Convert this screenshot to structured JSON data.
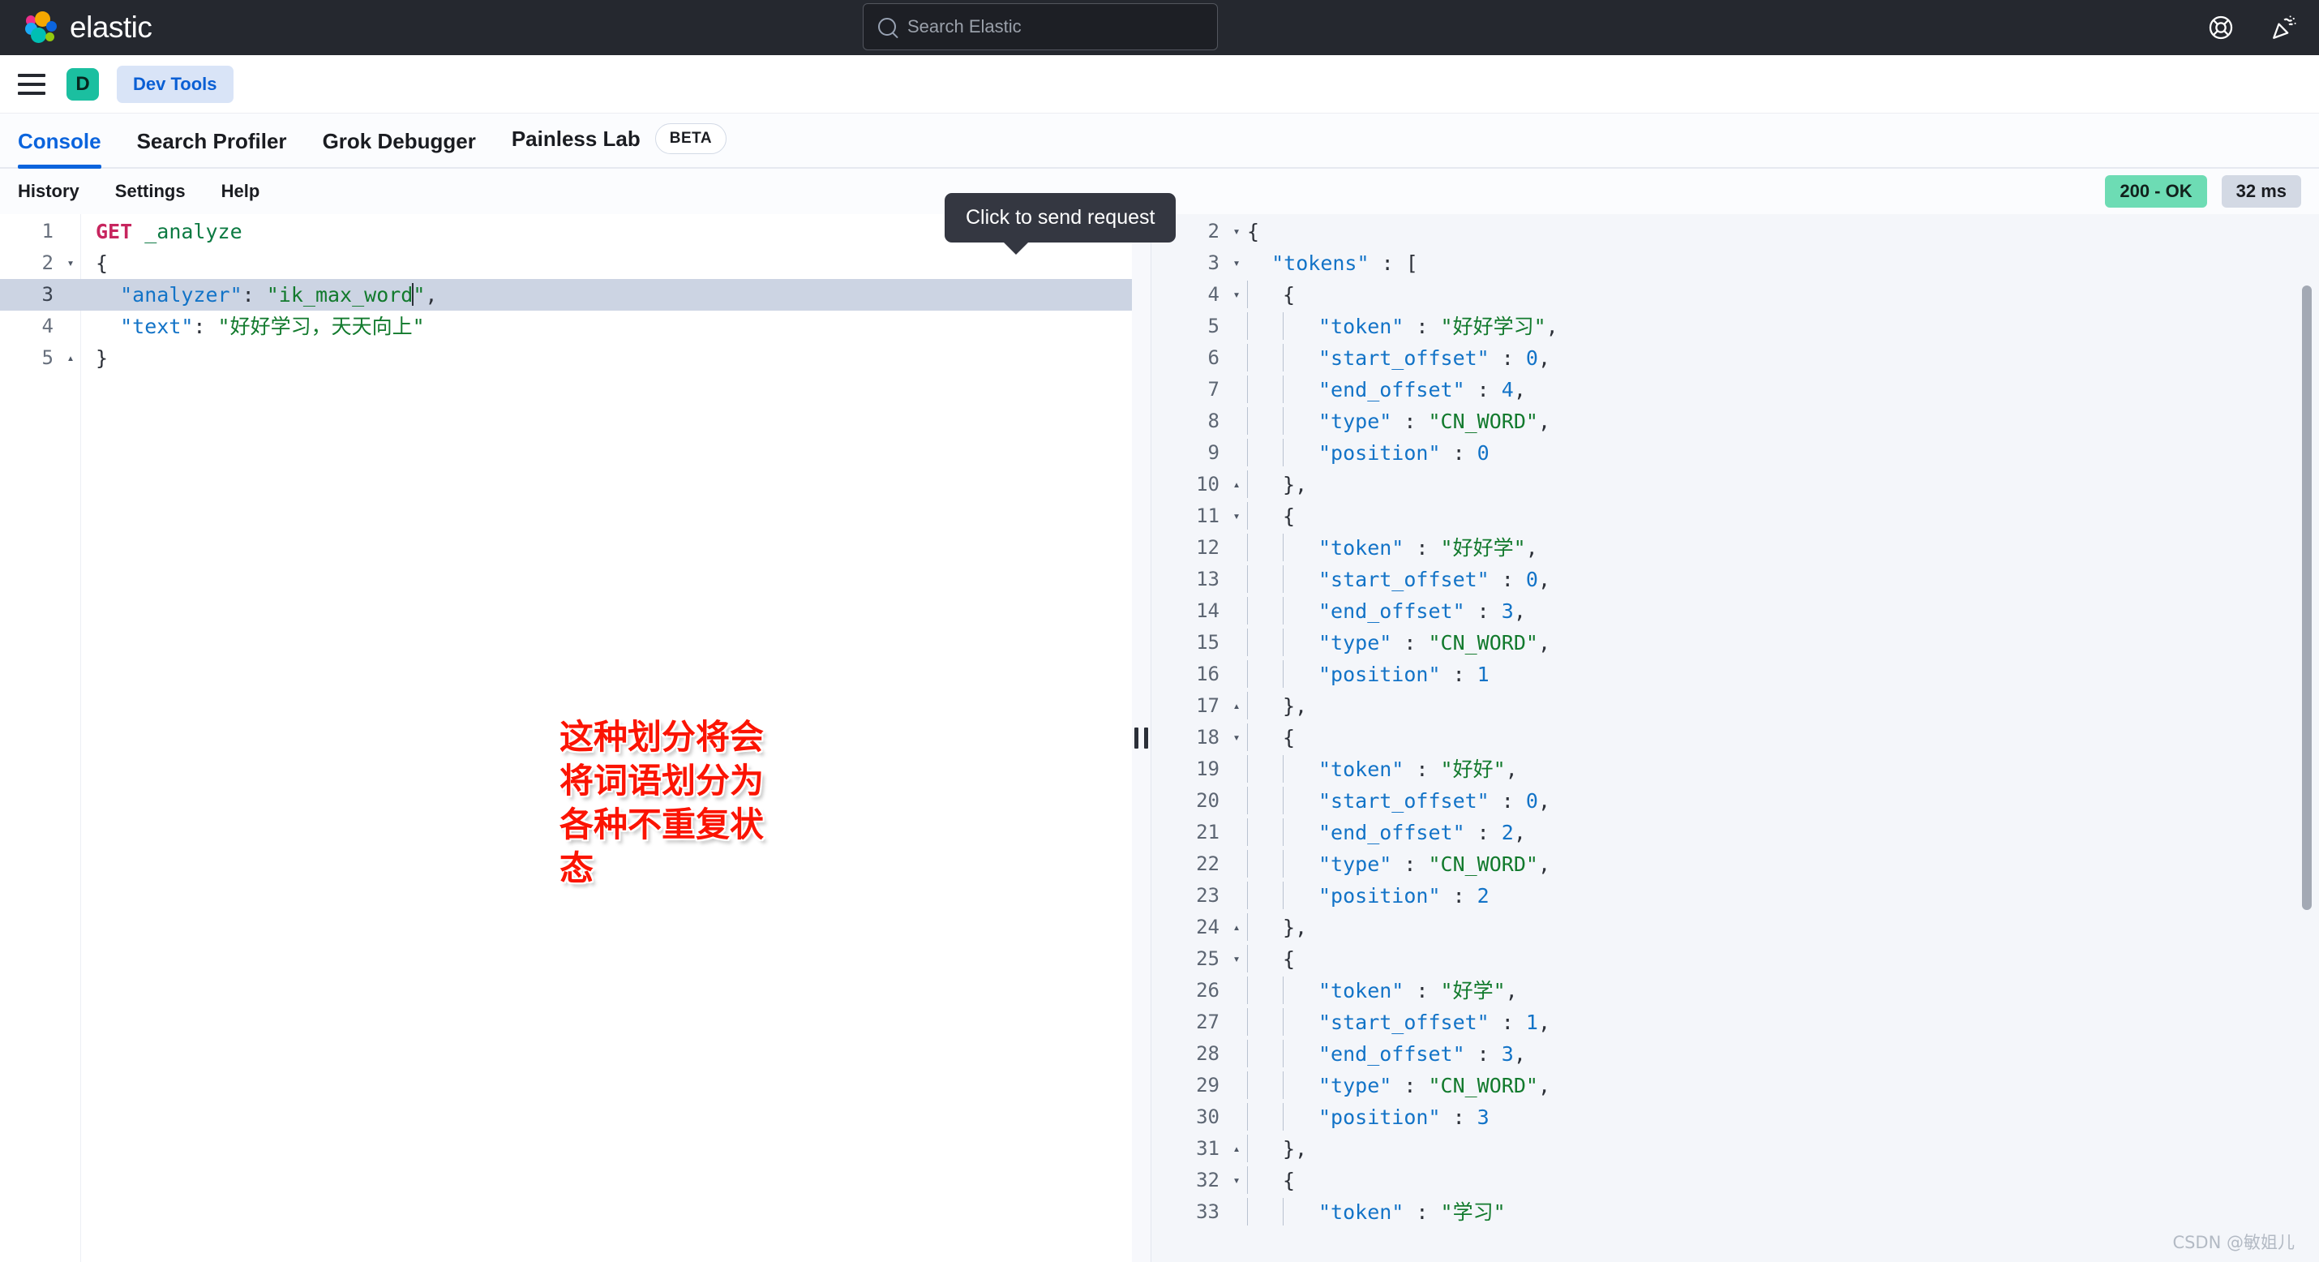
{
  "topbar": {
    "brand": "elastic",
    "brand_icon": "elastic-logo-icon",
    "search_placeholder": "Search Elastic",
    "search_icon": "search-icon",
    "help_icon": "lifebuoy-help-icon",
    "news_icon": "party-popper-news-icon",
    "bg": "#25282f"
  },
  "navbar": {
    "menu_icon": "hamburger-menu-icon",
    "space_initial": "D",
    "space_color": "#1bbfa0",
    "breadcrumb": "Dev Tools",
    "breadcrumb_color": "#0a5fd4"
  },
  "tabs": [
    {
      "label": "Console",
      "active": true
    },
    {
      "label": "Search Profiler",
      "active": false
    },
    {
      "label": "Grok Debugger",
      "active": false
    },
    {
      "label": "Painless Lab",
      "active": false,
      "badge": "BETA"
    }
  ],
  "actionbar": {
    "links": [
      "History",
      "Settings",
      "Help"
    ],
    "status": "200 - OK",
    "status_color": "#6ddcb4",
    "duration": "32 ms"
  },
  "tooltip": {
    "text": "Click to send request"
  },
  "run_controls": {
    "play_icon": "play-send-request-icon",
    "wrench_icon": "wrench-settings-icon",
    "play_color": "#0f7a63",
    "wrench_color": "#0b64dd"
  },
  "editor": {
    "lines": [
      {
        "n": "1",
        "fold": "",
        "active": false,
        "tokens": [
          {
            "t": "GET",
            "c": "k-method"
          },
          {
            "t": " ",
            "c": "k-plain"
          },
          {
            "t": "_analyze",
            "c": "k-url"
          }
        ]
      },
      {
        "n": "2",
        "fold": "▾",
        "active": false,
        "tokens": [
          {
            "t": "{",
            "c": "k-punct"
          }
        ]
      },
      {
        "n": "3",
        "fold": "",
        "active": true,
        "tokens": [
          {
            "t": "  ",
            "c": "k-plain"
          },
          {
            "t": "\"analyzer\"",
            "c": "k-key"
          },
          {
            "t": ": ",
            "c": "k-punct"
          },
          {
            "t": "\"ik_max_word\"",
            "c": "k-str"
          },
          {
            "t": ",",
            "c": "k-punct"
          }
        ]
      },
      {
        "n": "4",
        "fold": "",
        "active": false,
        "tokens": [
          {
            "t": "  ",
            "c": "k-plain"
          },
          {
            "t": "\"text\"",
            "c": "k-key"
          },
          {
            "t": ": ",
            "c": "k-punct"
          },
          {
            "t": "\"好好学习，天天向上\"",
            "c": "k-str"
          }
        ]
      },
      {
        "n": "5",
        "fold": "▴",
        "active": false,
        "tokens": [
          {
            "t": "}",
            "c": "k-punct"
          }
        ]
      }
    ]
  },
  "response": {
    "lines": [
      {
        "n": "2",
        "fold": "▾",
        "ind": 0,
        "tokens": [
          {
            "t": "{",
            "c": "k-punct"
          }
        ]
      },
      {
        "n": "3",
        "fold": "▾",
        "ind": 0,
        "tokens": [
          {
            "t": "  ",
            "c": "k-plain"
          },
          {
            "t": "\"tokens\"",
            "c": "k-key"
          },
          {
            "t": " : ",
            "c": "k-punct"
          },
          {
            "t": "[",
            "c": "k-punct"
          }
        ]
      },
      {
        "n": "4",
        "fold": "▾",
        "ind": 1,
        "tokens": [
          {
            "t": "{",
            "c": "k-punct"
          }
        ]
      },
      {
        "n": "5",
        "fold": "",
        "ind": 2,
        "tokens": [
          {
            "t": "\"token\"",
            "c": "k-key"
          },
          {
            "t": " : ",
            "c": "k-punct"
          },
          {
            "t": "\"好好学习\"",
            "c": "k-str"
          },
          {
            "t": ",",
            "c": "k-punct"
          }
        ]
      },
      {
        "n": "6",
        "fold": "",
        "ind": 2,
        "tokens": [
          {
            "t": "\"start_offset\"",
            "c": "k-key"
          },
          {
            "t": " : ",
            "c": "k-punct"
          },
          {
            "t": "0",
            "c": "k-num"
          },
          {
            "t": ",",
            "c": "k-punct"
          }
        ]
      },
      {
        "n": "7",
        "fold": "",
        "ind": 2,
        "tokens": [
          {
            "t": "\"end_offset\"",
            "c": "k-key"
          },
          {
            "t": " : ",
            "c": "k-punct"
          },
          {
            "t": "4",
            "c": "k-num"
          },
          {
            "t": ",",
            "c": "k-punct"
          }
        ]
      },
      {
        "n": "8",
        "fold": "",
        "ind": 2,
        "tokens": [
          {
            "t": "\"type\"",
            "c": "k-key"
          },
          {
            "t": " : ",
            "c": "k-punct"
          },
          {
            "t": "\"CN_WORD\"",
            "c": "k-str"
          },
          {
            "t": ",",
            "c": "k-punct"
          }
        ]
      },
      {
        "n": "9",
        "fold": "",
        "ind": 2,
        "tokens": [
          {
            "t": "\"position\"",
            "c": "k-key"
          },
          {
            "t": " : ",
            "c": "k-punct"
          },
          {
            "t": "0",
            "c": "k-num"
          }
        ]
      },
      {
        "n": "10",
        "fold": "▴",
        "ind": 1,
        "tokens": [
          {
            "t": "},",
            "c": "k-punct"
          }
        ]
      },
      {
        "n": "11",
        "fold": "▾",
        "ind": 1,
        "tokens": [
          {
            "t": "{",
            "c": "k-punct"
          }
        ]
      },
      {
        "n": "12",
        "fold": "",
        "ind": 2,
        "tokens": [
          {
            "t": "\"token\"",
            "c": "k-key"
          },
          {
            "t": " : ",
            "c": "k-punct"
          },
          {
            "t": "\"好好学\"",
            "c": "k-str"
          },
          {
            "t": ",",
            "c": "k-punct"
          }
        ]
      },
      {
        "n": "13",
        "fold": "",
        "ind": 2,
        "tokens": [
          {
            "t": "\"start_offset\"",
            "c": "k-key"
          },
          {
            "t": " : ",
            "c": "k-punct"
          },
          {
            "t": "0",
            "c": "k-num"
          },
          {
            "t": ",",
            "c": "k-punct"
          }
        ]
      },
      {
        "n": "14",
        "fold": "",
        "ind": 2,
        "tokens": [
          {
            "t": "\"end_offset\"",
            "c": "k-key"
          },
          {
            "t": " : ",
            "c": "k-punct"
          },
          {
            "t": "3",
            "c": "k-num"
          },
          {
            "t": ",",
            "c": "k-punct"
          }
        ]
      },
      {
        "n": "15",
        "fold": "",
        "ind": 2,
        "tokens": [
          {
            "t": "\"type\"",
            "c": "k-key"
          },
          {
            "t": " : ",
            "c": "k-punct"
          },
          {
            "t": "\"CN_WORD\"",
            "c": "k-str"
          },
          {
            "t": ",",
            "c": "k-punct"
          }
        ]
      },
      {
        "n": "16",
        "fold": "",
        "ind": 2,
        "tokens": [
          {
            "t": "\"position\"",
            "c": "k-key"
          },
          {
            "t": " : ",
            "c": "k-punct"
          },
          {
            "t": "1",
            "c": "k-num"
          }
        ]
      },
      {
        "n": "17",
        "fold": "▴",
        "ind": 1,
        "tokens": [
          {
            "t": "},",
            "c": "k-punct"
          }
        ]
      },
      {
        "n": "18",
        "fold": "▾",
        "ind": 1,
        "tokens": [
          {
            "t": "{",
            "c": "k-punct"
          }
        ]
      },
      {
        "n": "19",
        "fold": "",
        "ind": 2,
        "tokens": [
          {
            "t": "\"token\"",
            "c": "k-key"
          },
          {
            "t": " : ",
            "c": "k-punct"
          },
          {
            "t": "\"好好\"",
            "c": "k-str"
          },
          {
            "t": ",",
            "c": "k-punct"
          }
        ]
      },
      {
        "n": "20",
        "fold": "",
        "ind": 2,
        "tokens": [
          {
            "t": "\"start_offset\"",
            "c": "k-key"
          },
          {
            "t": " : ",
            "c": "k-punct"
          },
          {
            "t": "0",
            "c": "k-num"
          },
          {
            "t": ",",
            "c": "k-punct"
          }
        ]
      },
      {
        "n": "21",
        "fold": "",
        "ind": 2,
        "tokens": [
          {
            "t": "\"end_offset\"",
            "c": "k-key"
          },
          {
            "t": " : ",
            "c": "k-punct"
          },
          {
            "t": "2",
            "c": "k-num"
          },
          {
            "t": ",",
            "c": "k-punct"
          }
        ]
      },
      {
        "n": "22",
        "fold": "",
        "ind": 2,
        "tokens": [
          {
            "t": "\"type\"",
            "c": "k-key"
          },
          {
            "t": " : ",
            "c": "k-punct"
          },
          {
            "t": "\"CN_WORD\"",
            "c": "k-str"
          },
          {
            "t": ",",
            "c": "k-punct"
          }
        ]
      },
      {
        "n": "23",
        "fold": "",
        "ind": 2,
        "tokens": [
          {
            "t": "\"position\"",
            "c": "k-key"
          },
          {
            "t": " : ",
            "c": "k-punct"
          },
          {
            "t": "2",
            "c": "k-num"
          }
        ]
      },
      {
        "n": "24",
        "fold": "▴",
        "ind": 1,
        "tokens": [
          {
            "t": "},",
            "c": "k-punct"
          }
        ]
      },
      {
        "n": "25",
        "fold": "▾",
        "ind": 1,
        "tokens": [
          {
            "t": "{",
            "c": "k-punct"
          }
        ]
      },
      {
        "n": "26",
        "fold": "",
        "ind": 2,
        "tokens": [
          {
            "t": "\"token\"",
            "c": "k-key"
          },
          {
            "t": " : ",
            "c": "k-punct"
          },
          {
            "t": "\"好学\"",
            "c": "k-str"
          },
          {
            "t": ",",
            "c": "k-punct"
          }
        ]
      },
      {
        "n": "27",
        "fold": "",
        "ind": 2,
        "tokens": [
          {
            "t": "\"start_offset\"",
            "c": "k-key"
          },
          {
            "t": " : ",
            "c": "k-punct"
          },
          {
            "t": "1",
            "c": "k-num"
          },
          {
            "t": ",",
            "c": "k-punct"
          }
        ]
      },
      {
        "n": "28",
        "fold": "",
        "ind": 2,
        "tokens": [
          {
            "t": "\"end_offset\"",
            "c": "k-key"
          },
          {
            "t": " : ",
            "c": "k-punct"
          },
          {
            "t": "3",
            "c": "k-num"
          },
          {
            "t": ",",
            "c": "k-punct"
          }
        ]
      },
      {
        "n": "29",
        "fold": "",
        "ind": 2,
        "tokens": [
          {
            "t": "\"type\"",
            "c": "k-key"
          },
          {
            "t": " : ",
            "c": "k-punct"
          },
          {
            "t": "\"CN_WORD\"",
            "c": "k-str"
          },
          {
            "t": ",",
            "c": "k-punct"
          }
        ]
      },
      {
        "n": "30",
        "fold": "",
        "ind": 2,
        "tokens": [
          {
            "t": "\"position\"",
            "c": "k-key"
          },
          {
            "t": " : ",
            "c": "k-punct"
          },
          {
            "t": "3",
            "c": "k-num"
          }
        ]
      },
      {
        "n": "31",
        "fold": "▴",
        "ind": 1,
        "tokens": [
          {
            "t": "},",
            "c": "k-punct"
          }
        ]
      },
      {
        "n": "32",
        "fold": "▾",
        "ind": 1,
        "tokens": [
          {
            "t": "{",
            "c": "k-punct"
          }
        ]
      },
      {
        "n": "33",
        "fold": "",
        "ind": 2,
        "tokens": [
          {
            "t": "\"token\"",
            "c": "k-key"
          },
          {
            "t": " : ",
            "c": "k-punct"
          },
          {
            "t": "\"学习\"",
            "c": "k-str"
          }
        ]
      }
    ]
  },
  "annotation": {
    "text": "这种划分将会将词语划分为各种不重复状态",
    "color": "#fb1403"
  },
  "watermark": {
    "text": "CSDN @敏姐儿"
  },
  "splitter": {
    "icon": "resize-grip-icon"
  },
  "scrollbar": {
    "icon": "vertical-scrollbar-thumb"
  }
}
